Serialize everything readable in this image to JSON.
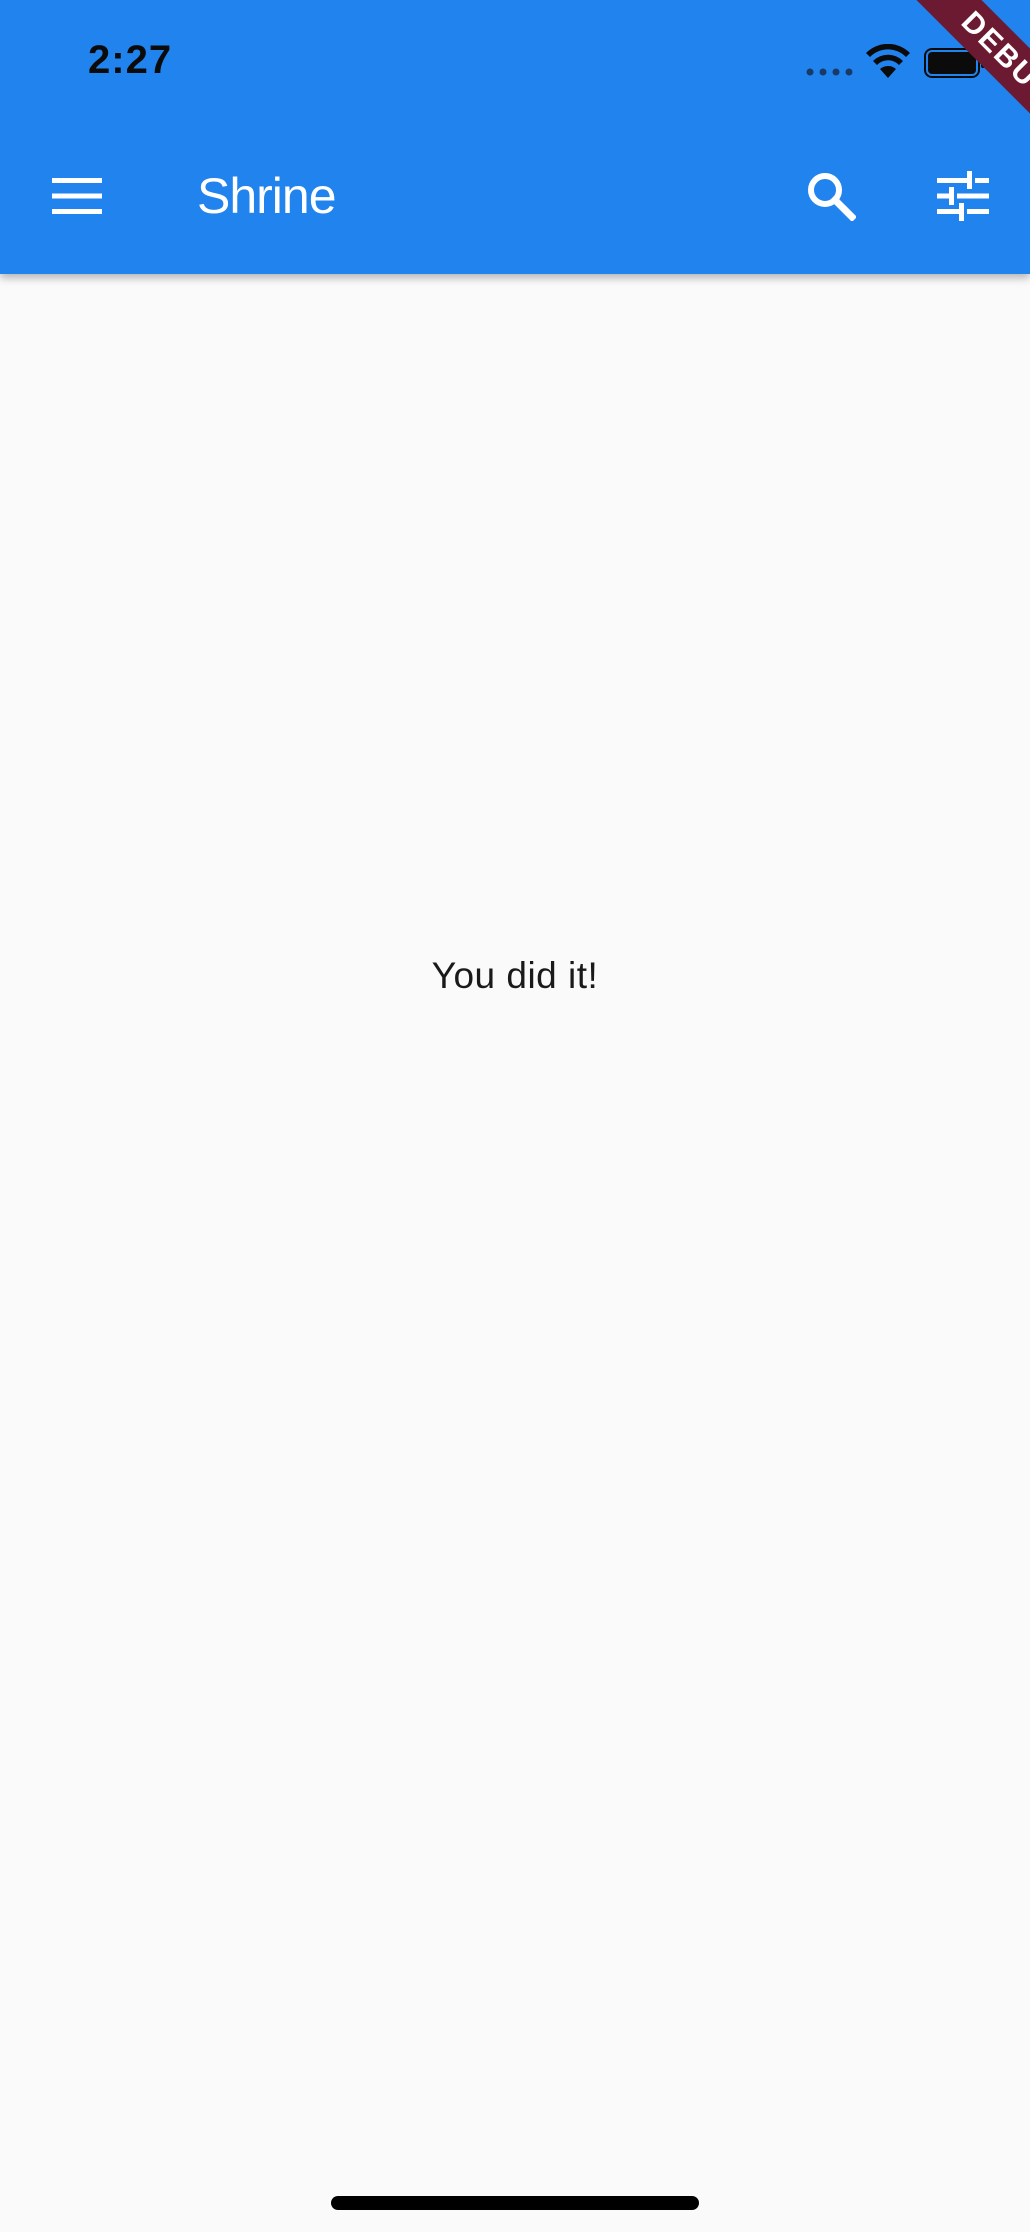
{
  "status_bar": {
    "time": "2:27"
  },
  "app_bar": {
    "title": "Shrine",
    "menu_icon": "menu-icon",
    "search_icon": "search-icon",
    "filter_icon": "tune-icon",
    "background_color": "#2083ee"
  },
  "debug_banner": {
    "label": "DEBUG",
    "color": "#6b1a32"
  },
  "main": {
    "message": "You did it!"
  }
}
